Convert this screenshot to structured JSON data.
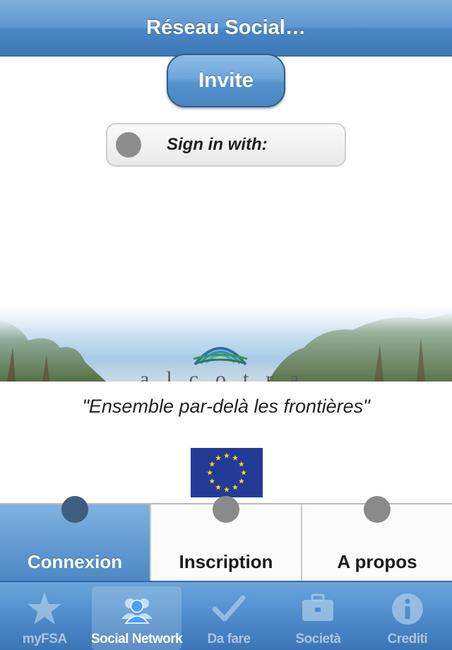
{
  "navbar": {
    "title": "Réseau Social…"
  },
  "invite_button": {
    "label": "Invite"
  },
  "signin": {
    "label": "Sign in with:"
  },
  "banner": {
    "logo_text": "alcotra"
  },
  "tagline": "\"Ensemble par-delà les frontières\"",
  "segments": [
    {
      "label": "Connexion",
      "active": true
    },
    {
      "label": "Inscription",
      "active": false
    },
    {
      "label": "A propos",
      "active": false
    }
  ],
  "tabbar": {
    "items": [
      {
        "label": "myFSA",
        "icon": "star-icon",
        "active": false
      },
      {
        "label": "Social Network",
        "icon": "people-icon",
        "active": true
      },
      {
        "label": "Da fare",
        "icon": "checkmark-icon",
        "active": false
      },
      {
        "label": "Società",
        "icon": "briefcase-icon",
        "active": false
      },
      {
        "label": "Crediti",
        "icon": "info-icon",
        "active": false
      }
    ]
  },
  "colors": {
    "accent": "#5f98d0",
    "eu_blue": "#233a96",
    "eu_star": "#ffd800"
  }
}
